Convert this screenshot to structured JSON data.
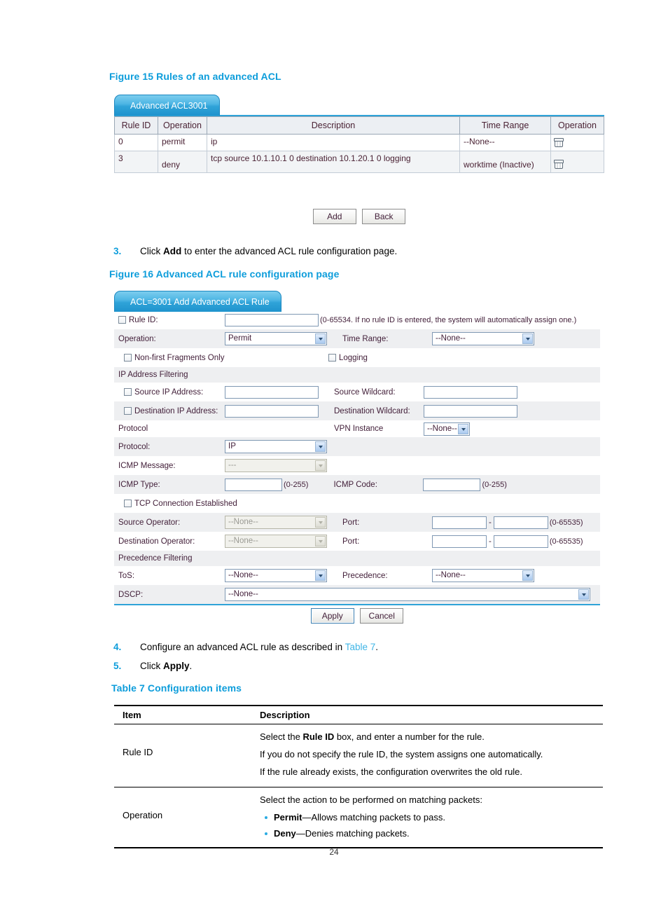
{
  "page_number": "24",
  "figure15": {
    "title": "Figure 15 Rules of an advanced ACL",
    "tab_label": "Advanced ACL3001",
    "columns": [
      "Rule ID",
      "Operation",
      "Description",
      "Time Range",
      "Operation"
    ],
    "rows": [
      {
        "rule_id": "0",
        "operation": "permit",
        "description": "ip",
        "time_range": "--None--",
        "action_icon": "trash-icon"
      },
      {
        "rule_id": "3",
        "operation": "deny",
        "description": "tcp source 10.1.10.1 0 destination 10.1.20.1 0 logging",
        "time_range": "worktime (Inactive)",
        "action_icon": "trash-icon"
      }
    ],
    "buttons": {
      "add": "Add",
      "back": "Back"
    }
  },
  "step3": {
    "num": "3.",
    "text_before": "Click ",
    "bold": "Add",
    "text_after": " to enter the advanced ACL rule configuration page."
  },
  "figure16": {
    "title": "Figure 16 Advanced ACL rule configuration page",
    "tab_label": "ACL=3001 Add Advanced ACL Rule",
    "rule_id": {
      "label": "Rule ID:",
      "value": "",
      "hint": "(0-65534. If no rule ID is entered, the system will automatically assign one.)"
    },
    "operation": {
      "label": "Operation:",
      "value": "Permit"
    },
    "time_range": {
      "label": "Time Range:",
      "value": "--None--"
    },
    "non_first_fragments": {
      "label": "Non-first Fragments Only"
    },
    "logging": {
      "label": "Logging"
    },
    "section_ip": "IP Address Filtering",
    "source_ip": {
      "label": "Source IP Address:",
      "value": ""
    },
    "source_wildcard": {
      "label": "Source Wildcard:",
      "value": ""
    },
    "dest_ip": {
      "label": "Destination IP Address:",
      "value": ""
    },
    "dest_wildcard": {
      "label": "Destination Wildcard:",
      "value": ""
    },
    "section_protocol": "Protocol",
    "vpn_instance": {
      "label": "VPN Instance",
      "value": "--None--"
    },
    "protocol": {
      "label": "Protocol:",
      "value": "IP"
    },
    "icmp_message": {
      "label": "ICMP Message:",
      "value": "---"
    },
    "icmp_type": {
      "label": "ICMP Type:",
      "value": "",
      "hint": "(0-255)"
    },
    "icmp_code": {
      "label": "ICMP Code:",
      "value": "",
      "hint": "(0-255)"
    },
    "tcp_established": {
      "label": "TCP Connection Established"
    },
    "source_operator": {
      "label": "Source Operator:",
      "value": "--None--"
    },
    "source_port": {
      "label": "Port:",
      "from": "",
      "to": "",
      "sep": "-",
      "hint": "(0-65535)"
    },
    "dest_operator": {
      "label": "Destination Operator:",
      "value": "--None--"
    },
    "dest_port": {
      "label": "Port:",
      "from": "",
      "to": "",
      "sep": "-",
      "hint": "(0-65535)"
    },
    "section_precedence": "Precedence Filtering",
    "tos": {
      "label": "ToS:",
      "value": "--None--"
    },
    "precedence": {
      "label": "Precedence:",
      "value": "--None--"
    },
    "dscp": {
      "label": "DSCP:",
      "value": "--None--"
    },
    "buttons": {
      "apply": "Apply",
      "cancel": "Cancel"
    }
  },
  "step4": {
    "num": "4.",
    "text_before": "Configure an advanced ACL rule as described in ",
    "link": "Table 7",
    "text_after": "."
  },
  "step5": {
    "num": "5.",
    "text_before": "Click ",
    "bold": "Apply",
    "text_after": "."
  },
  "table7": {
    "title": "Table 7 Configuration items",
    "headers": {
      "item": "Item",
      "description": "Description"
    },
    "rows": [
      {
        "item": "Rule ID",
        "lines": [
          {
            "pre": "Select the ",
            "bold": "Rule ID",
            "post": " box, and enter a number for the rule."
          },
          {
            "pre": "If you do not specify the rule ID, the system assigns one automatically.",
            "bold": "",
            "post": ""
          },
          {
            "pre": "If the rule already exists, the configuration overwrites the old rule.",
            "bold": "",
            "post": ""
          }
        ],
        "bullets": []
      },
      {
        "item": "Operation",
        "lines": [
          {
            "pre": "Select the action to be performed on matching packets:",
            "bold": "",
            "post": ""
          }
        ],
        "bullets": [
          {
            "bold": "Permit",
            "rest": "—Allows matching packets to pass."
          },
          {
            "bold": "Deny",
            "rest": "—Denies matching packets."
          }
        ]
      }
    ]
  },
  "colors": {
    "accent": "#0d9ddb",
    "tab_blue": "#2fa3d8",
    "bullet": "#29abe2"
  }
}
